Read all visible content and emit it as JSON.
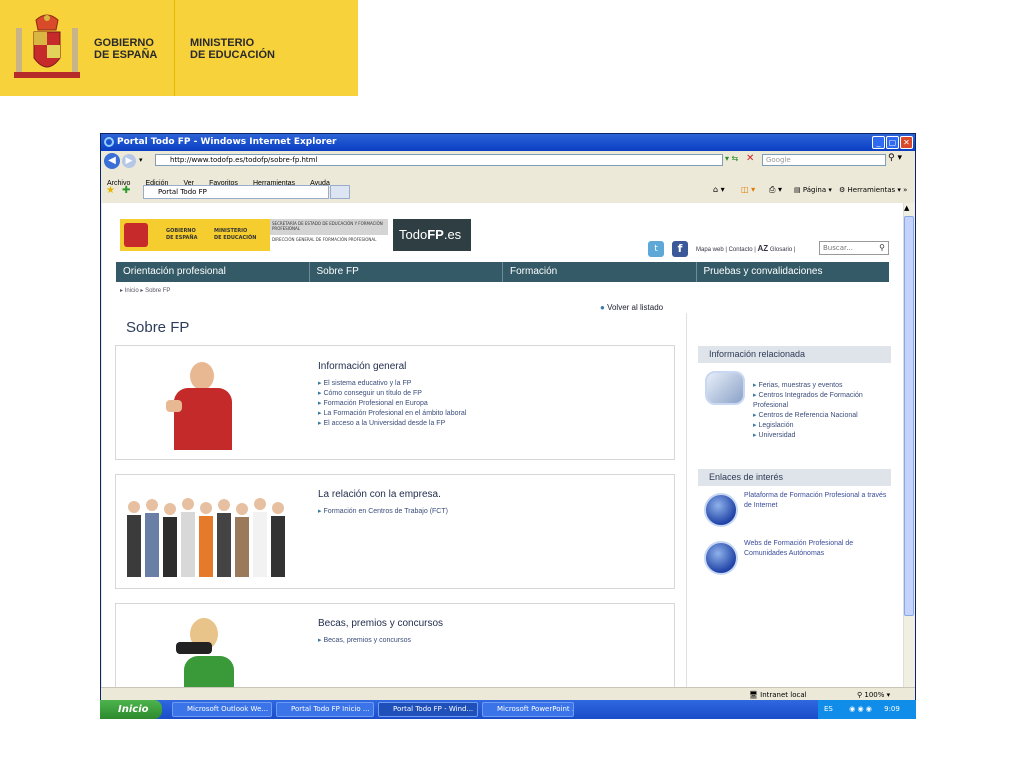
{
  "banner": {
    "line1": "GOBIERNO",
    "line2": "DE ESPAÑA",
    "line3": "MINISTERIO",
    "line4": "DE EDUCACIÓN"
  },
  "window": {
    "title": "Portal Todo FP - Windows Internet Explorer",
    "url": "http://www.todofp.es/todofp/sobre-fp.html",
    "search_placeholder": "Google",
    "menu": [
      "Archivo",
      "Edición",
      "Ver",
      "Favoritos",
      "Herramientas",
      "Ayuda"
    ],
    "tab": "Portal Todo FP",
    "toolbar": {
      "page": "Página",
      "tools": "Herramientas"
    }
  },
  "site": {
    "logo_gov1": "GOBIERNO",
    "logo_gov2": "DE ESPAÑA",
    "logo_min1": "MINISTERIO",
    "logo_min2": "DE EDUCACIÓN",
    "secretaria": "SECRETARÍA DE ESTADO DE EDUCACIÓN Y FORMACIÓN PROFESIONAL",
    "direccion": "DIRECCIÓN GENERAL DE FORMACIÓN PROFESIONAL",
    "brand_a": "Todo",
    "brand_b": "FP",
    "brand_c": ".es",
    "util": {
      "mapa": "Mapa web",
      "contacto": "Contacto",
      "az": "AZ",
      "glosario": "Glosario",
      "buscar": "Buscar..."
    },
    "nav": [
      "Orientación profesional",
      "Sobre FP",
      "Formación",
      "Pruebas y convalidaciones"
    ],
    "breadcrumb": {
      "home": "Inicio",
      "current": "Sobre FP"
    },
    "volver": "Volver al listado",
    "page_title": "Sobre FP",
    "sections": [
      {
        "title": "Información general",
        "links": [
          "El sistema educativo y la FP",
          "Cómo conseguir un título de FP",
          "Formación Profesional en Europa",
          "La Formación Profesional en el ámbito laboral",
          "El acceso a la Universidad desde la FP"
        ]
      },
      {
        "title": "La relación con la empresa.",
        "links": [
          "Formación en Centros de Trabajo (FCT)"
        ]
      },
      {
        "title": "Becas, premios y concursos",
        "links": [
          "Becas, premios y concursos"
        ]
      }
    ],
    "related_title": "Información relacionada",
    "related": [
      "Ferias, muestras y eventos",
      "Centros Integrados de Formación Profesional",
      "Centros de Referencia Nacional",
      "Legislación",
      "Universidad"
    ],
    "interest_title": "Enlaces de interés",
    "interest": [
      "Plataforma de Formación Profesional a través de Internet",
      "Webs de Formación Profesional de Comunidades Autónomas"
    ]
  },
  "status": {
    "zone": "Intranet local",
    "zoom": "100%"
  },
  "taskbar": {
    "start": "Inicio",
    "tasks": [
      "Microsoft Outlook We...",
      "Portal Todo FP Inicio ...",
      "Portal Todo FP - Wind...",
      "Microsoft PowerPoint ..."
    ],
    "lang": "ES",
    "time": "9:09"
  },
  "colors": {
    "banner": "#f8d23a",
    "nav": "#335a66",
    "accent": "#c4a43a"
  }
}
